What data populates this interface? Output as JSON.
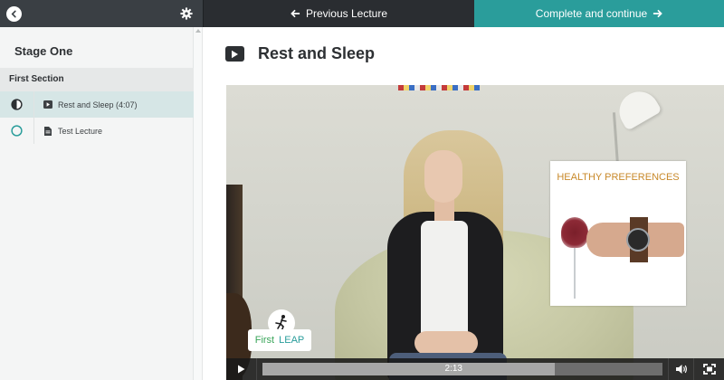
{
  "topbar": {
    "prev_label": "Previous Lecture",
    "next_label": "Complete and continue",
    "accent": "#2a9d9b"
  },
  "sidebar": {
    "stage_title": "Stage One",
    "section_title": "First Section",
    "lectures": [
      {
        "label": "Rest and Sleep (4:07)",
        "icon": "video-icon",
        "status": "in-progress",
        "active": true
      },
      {
        "label": "Test Lecture",
        "icon": "document-icon",
        "status": "not-started",
        "active": false
      }
    ]
  },
  "main": {
    "lecture_title": "Rest and Sleep"
  },
  "video": {
    "card_title": "HEALTHY PREFERENCES",
    "logo_first": "First",
    "logo_leap": "LEAP",
    "current_time": "2:13",
    "progress_fraction": 0.478,
    "buffered_fraction": 0.73
  }
}
